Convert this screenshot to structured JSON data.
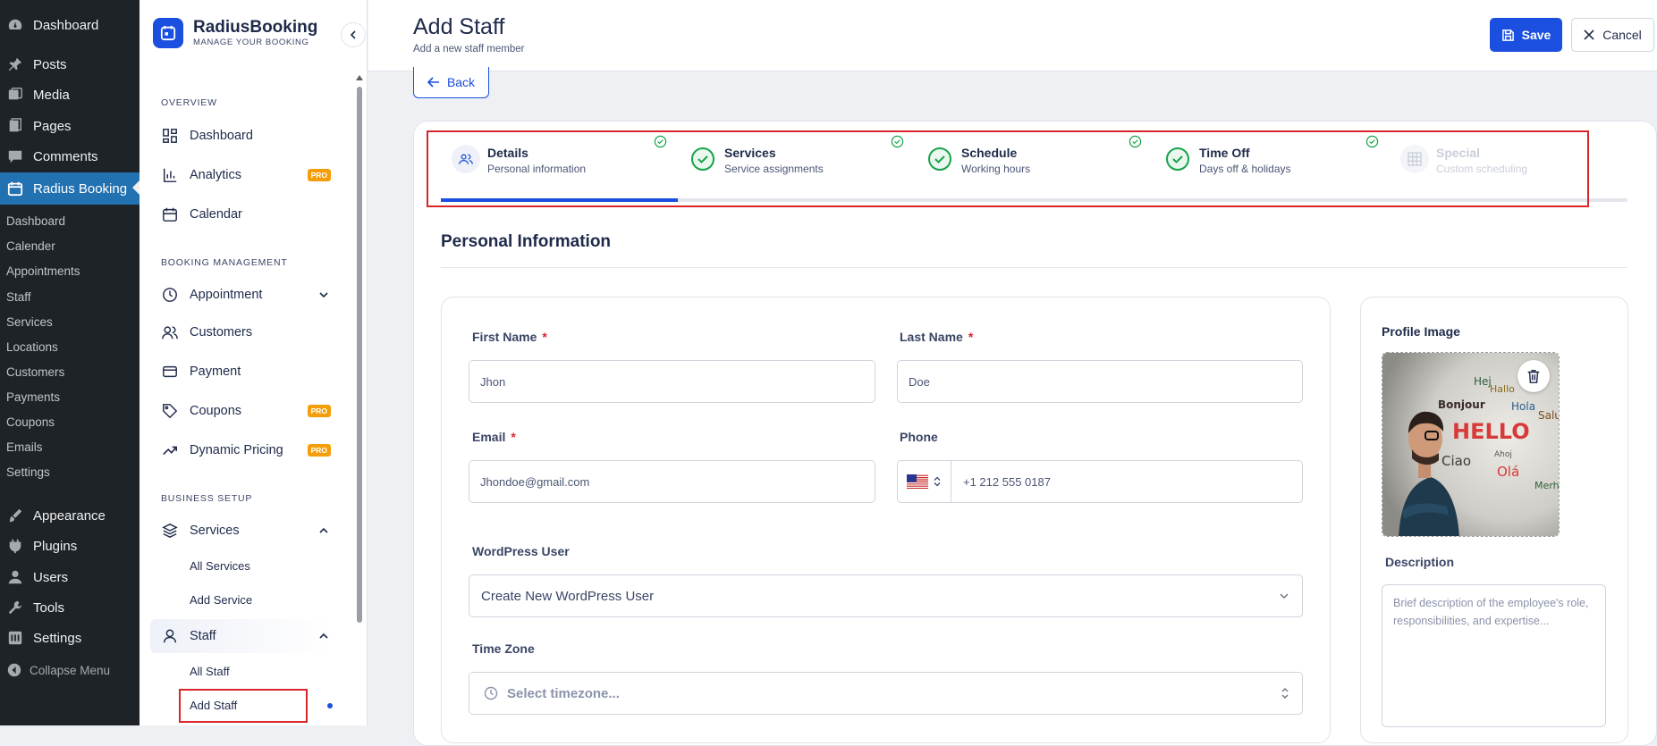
{
  "wp_menu": {
    "items": [
      {
        "label": "Dashboard",
        "icon": "dashboard-icon"
      },
      {
        "label": "Posts",
        "icon": "pin-icon"
      },
      {
        "label": "Media",
        "icon": "media-icon"
      },
      {
        "label": "Pages",
        "icon": "pages-icon"
      },
      {
        "label": "Comments",
        "icon": "comment-icon"
      },
      {
        "label": "Radius Booking",
        "icon": "calendar-icon"
      }
    ],
    "submenu": [
      "Dashboard",
      "Calender",
      "Appointments",
      "Staff",
      "Services",
      "Locations",
      "Customers",
      "Payments",
      "Coupons",
      "Emails",
      "Settings"
    ],
    "items2": [
      {
        "label": "Appearance",
        "icon": "brush-icon"
      },
      {
        "label": "Plugins",
        "icon": "plug-icon"
      },
      {
        "label": "Users",
        "icon": "user-icon"
      },
      {
        "label": "Tools",
        "icon": "wrench-icon"
      },
      {
        "label": "Settings",
        "icon": "settings-icon"
      }
    ],
    "collapse": "Collapse Menu"
  },
  "brand": {
    "name": "RadiusBooking",
    "tagline": "MANAGE YOUR BOOKING",
    "color": "#1a4fe0"
  },
  "plugin_nav": {
    "overview_title": "OVERVIEW",
    "overview": [
      {
        "label": "Dashboard",
        "icon": "grid-icon"
      },
      {
        "label": "Analytics",
        "icon": "bar-chart-icon",
        "badge": "PRO"
      },
      {
        "label": "Calendar",
        "icon": "calendar-icon"
      }
    ],
    "booking_title": "BOOKING MANAGEMENT",
    "booking": [
      {
        "label": "Appointment",
        "icon": "clock-icon"
      },
      {
        "label": "Customers",
        "icon": "users-icon"
      },
      {
        "label": "Payment",
        "icon": "card-icon"
      },
      {
        "label": "Coupons",
        "icon": "tag-icon",
        "badge": "PRO"
      },
      {
        "label": "Dynamic Pricing",
        "icon": "trending-icon",
        "badge": "PRO"
      }
    ],
    "business_title": "BUSINESS SETUP",
    "services": {
      "label": "Services",
      "icon": "layers-icon",
      "children": [
        "All Services",
        "Add Service"
      ]
    },
    "staff": {
      "label": "Staff",
      "icon": "user-icon",
      "children": [
        "All Staff",
        "Add Staff"
      ]
    }
  },
  "header": {
    "title": "Add Staff",
    "subtitle": "Add a new staff member",
    "save": "Save",
    "cancel": "Cancel"
  },
  "back": "Back",
  "steps": [
    {
      "title": "Details",
      "sub": "Personal information",
      "state": "active"
    },
    {
      "title": "Services",
      "sub": "Service assignments",
      "state": "done"
    },
    {
      "title": "Schedule",
      "sub": "Working hours",
      "state": "done"
    },
    {
      "title": "Time Off",
      "sub": "Days off & holidays",
      "state": "done"
    },
    {
      "title": "Special",
      "sub": "Custom scheduling",
      "state": "disabled"
    }
  ],
  "section_title": "Personal Information",
  "form": {
    "first_name": {
      "label": "First Name",
      "value": "Jhon"
    },
    "last_name": {
      "label": "Last Name",
      "value": "Doe"
    },
    "email": {
      "label": "Email",
      "value": "Jhondoe@gmail.com"
    },
    "phone": {
      "label": "Phone",
      "value": "+1 212 555 0187",
      "country": "US"
    },
    "wp_user": {
      "label": "WordPress User",
      "value": "Create New WordPress User"
    },
    "timezone": {
      "label": "Time Zone",
      "placeholder": "Select timezone..."
    },
    "required_mark": "*"
  },
  "profile": {
    "label": "Profile Image",
    "description_label": "Description",
    "description_placeholder": "Brief description of the employee's role, responsibilities, and expertise...",
    "image_words": [
      "Hej",
      "Bonjour",
      "HELLO",
      "Ciao",
      "Olá",
      "Hola",
      "Salut",
      "Hallo",
      "Ahoj",
      "Merhaba"
    ]
  }
}
